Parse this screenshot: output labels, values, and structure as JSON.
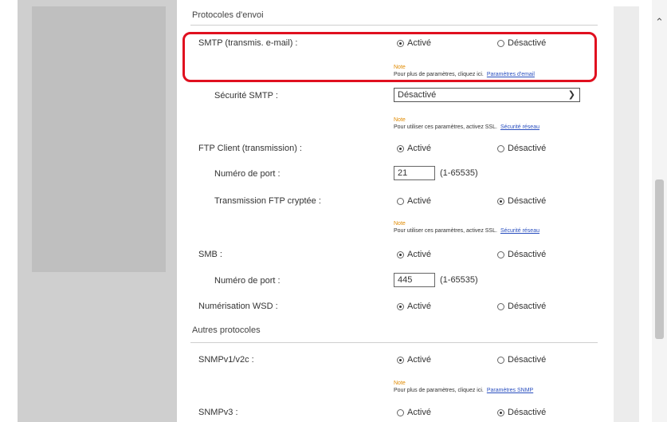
{
  "send_section": {
    "title": "Protocoles d'envoi"
  },
  "other_section": {
    "title": "Autres protocoles"
  },
  "options": {
    "on": "Activé",
    "off": "Désactivé"
  },
  "smtp": {
    "label": "SMTP (transmis. e-mail) :",
    "value": "on",
    "note_title": "Note",
    "note_text": "Pour plus de paramètres, cliquez ici.",
    "note_link": "Paramètres d'email"
  },
  "smtp_security": {
    "label": "Sécurité SMTP :",
    "selected": "Désactivé",
    "note_title": "Note",
    "note_text": "Pour utiliser ces paramètres, activez SSL.",
    "note_link": "Sécurité réseau"
  },
  "ftp_client": {
    "label": "FTP Client (transmission) :",
    "value": "on"
  },
  "ftp_port": {
    "label": "Numéro de port :",
    "value": "21",
    "range": "(1-65535)"
  },
  "ftp_encrypted": {
    "label": "Transmission FTP cryptée :",
    "value": "off",
    "note_title": "Note",
    "note_text": "Pour utiliser ces paramètres, activez SSL.",
    "note_link": "Sécurité réseau"
  },
  "smb": {
    "label": "SMB :",
    "value": "on"
  },
  "smb_port": {
    "label": "Numéro de port :",
    "value": "445",
    "range": "(1-65535)"
  },
  "wsd_scan": {
    "label": "Numérisation WSD :",
    "value": "on"
  },
  "snmpv1": {
    "label": "SNMPv1/v2c :",
    "value": "on",
    "note_title": "Note",
    "note_text": "Pour plus de paramètres, cliquez ici.",
    "note_link": "Paramètres SNMP"
  },
  "snmpv3": {
    "label": "SNMPv3 :",
    "value": "off"
  },
  "colors": {
    "highlight": "#e0101f",
    "link": "#2a4fbf",
    "note": "#e08a00"
  }
}
